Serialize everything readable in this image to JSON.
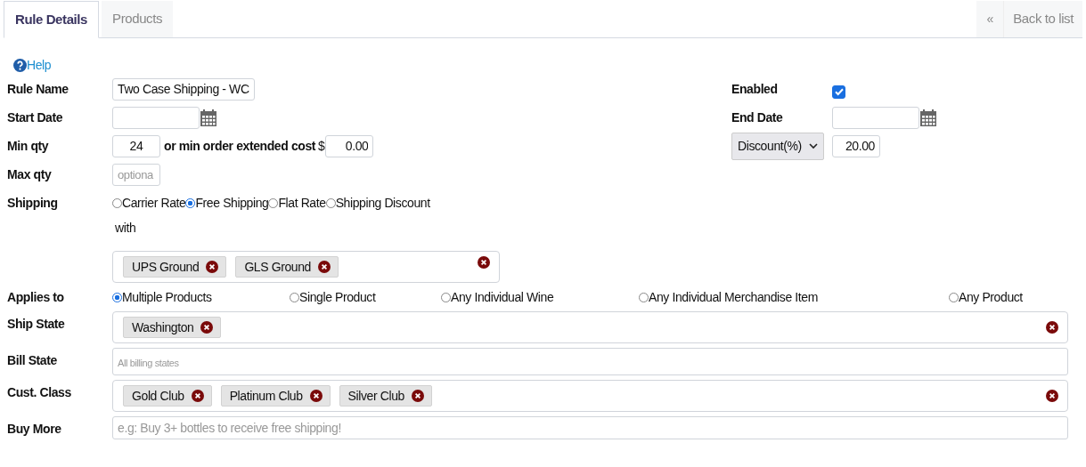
{
  "tabs": [
    {
      "label": "Rule Details",
      "selected": true
    },
    {
      "label": "Products",
      "selected": false
    }
  ],
  "back_link": {
    "icon": "«",
    "label": "Back to list"
  },
  "help_link": "Help",
  "rule_name": {
    "label": "Rule Name",
    "value": "Two Case Shipping - WC"
  },
  "enabled": {
    "label": "Enabled",
    "checked": true
  },
  "start_date": {
    "label": "Start Date"
  },
  "end_date": {
    "label": "End Date"
  },
  "min_qty": {
    "label": "Min qty",
    "value": "24",
    "cost_label": "or min order extended cost",
    "currency": "$",
    "cost_value": "0.00"
  },
  "discount": {
    "select": "Discount(%)",
    "value": "20.00"
  },
  "max_qty": {
    "label": "Max qty",
    "placeholder": "optiona"
  },
  "shipping": {
    "label": "Shipping",
    "options": [
      {
        "label": "Carrier Rate",
        "selected": false
      },
      {
        "label": "Free Shipping",
        "selected": true
      },
      {
        "label": "Flat Rate",
        "selected": false
      },
      {
        "label": "Shipping Discount",
        "selected": false
      }
    ],
    "with_label": "with",
    "carriers": [
      "UPS Ground",
      "GLS Ground"
    ]
  },
  "applies_to": {
    "label": "Applies to",
    "options": [
      {
        "label": "Multiple Products",
        "selected": true
      },
      {
        "label": "Single Product",
        "selected": false
      },
      {
        "label": "Any Individual Wine",
        "selected": false
      },
      {
        "label": "Any Individual Merchandise Item",
        "selected": false
      },
      {
        "label": "Any Product",
        "selected": false
      }
    ]
  },
  "ship_state": {
    "label": "Ship State",
    "tags": [
      "Washington"
    ]
  },
  "bill_state": {
    "label": "Bill State",
    "placeholder": "All billing states"
  },
  "cust_class": {
    "label": "Cust. Class",
    "tags": [
      "Gold Club",
      "Platinum Club",
      "Silver Club"
    ]
  },
  "buy_more": {
    "label": "Buy More",
    "placeholder": "e.g: Buy 3+ bottles to receive free shipping!"
  }
}
